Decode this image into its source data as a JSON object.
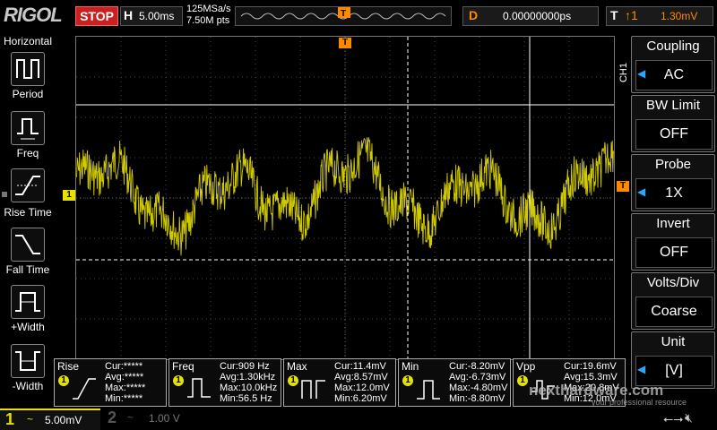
{
  "header": {
    "brand": "RIGOL",
    "run_state": "STOP",
    "timebase_label": "H",
    "timebase_value": "5.00ms",
    "sample_rate": "125MSa/s",
    "memory_depth": "7.50M pts",
    "delay_label": "D",
    "delay_value": "0.00000000ps",
    "trigger_label": "T",
    "trigger_level": "1.30mV"
  },
  "horizontal_panel": {
    "title": "Horizontal",
    "items": [
      {
        "label": "Period",
        "icon": "period-icon"
      },
      {
        "label": "Freq",
        "icon": "frequency-icon"
      },
      {
        "label": "Rise Time",
        "icon": "rise-time-icon"
      },
      {
        "label": "Fall Time",
        "icon": "fall-time-icon"
      },
      {
        "label": "+Width",
        "icon": "positive-width-icon"
      },
      {
        "label": "-Width",
        "icon": "negative-width-icon"
      }
    ]
  },
  "channel_menu": {
    "tag": "CH1",
    "items": [
      {
        "title": "Coupling",
        "value": "AC"
      },
      {
        "title": "BW Limit",
        "value": "OFF"
      },
      {
        "title": "Probe",
        "value": "1X"
      },
      {
        "title": "Invert",
        "value": "OFF"
      },
      {
        "title": "Volts/Div",
        "value": "Coarse"
      },
      {
        "title": "Unit",
        "value": "[V]"
      }
    ]
  },
  "measurements": [
    {
      "name": "Rise",
      "cur": "Cur:*****",
      "avg": "Avg:*****",
      "max": "Max:*****",
      "min": "Min:*****"
    },
    {
      "name": "Freq",
      "cur": "Cur:909 Hz",
      "avg": "Avg:1.30kHz",
      "max": "Max:10.0kHz",
      "min": "Min:56.5 Hz"
    },
    {
      "name": "Max",
      "cur": "Cur:11.4mV",
      "avg": "Avg:8.57mV",
      "max": "Max:12.0mV",
      "min": "Min:6.20mV"
    },
    {
      "name": "Min",
      "cur": "Cur:-8.20mV",
      "avg": "Avg:-6.73mV",
      "max": "Max:-4.80mV",
      "min": "Min:-8.80mV"
    },
    {
      "name": "Vpp",
      "cur": "Cur:19.6mV",
      "avg": "Avg:15.3mV",
      "max": "Max:20.8mV",
      "min": "Min:12.0mV"
    }
  ],
  "channels": [
    {
      "number": "1",
      "coupling": "~",
      "scale": "5.00mV",
      "color": "#e8e000"
    },
    {
      "number": "2",
      "coupling": "~",
      "scale": "1.00 V",
      "color": "#555555"
    }
  ],
  "markers": {
    "ch1": "1",
    "trigger": "T"
  },
  "watermark": {
    "brand": "nexthardware.com",
    "tagline": "your professional resource"
  },
  "colors": {
    "trace": "#e8e000",
    "accent": "#ff8a00",
    "stop": "#cc1f1f",
    "menu_arrow": "#2ba6ff"
  }
}
